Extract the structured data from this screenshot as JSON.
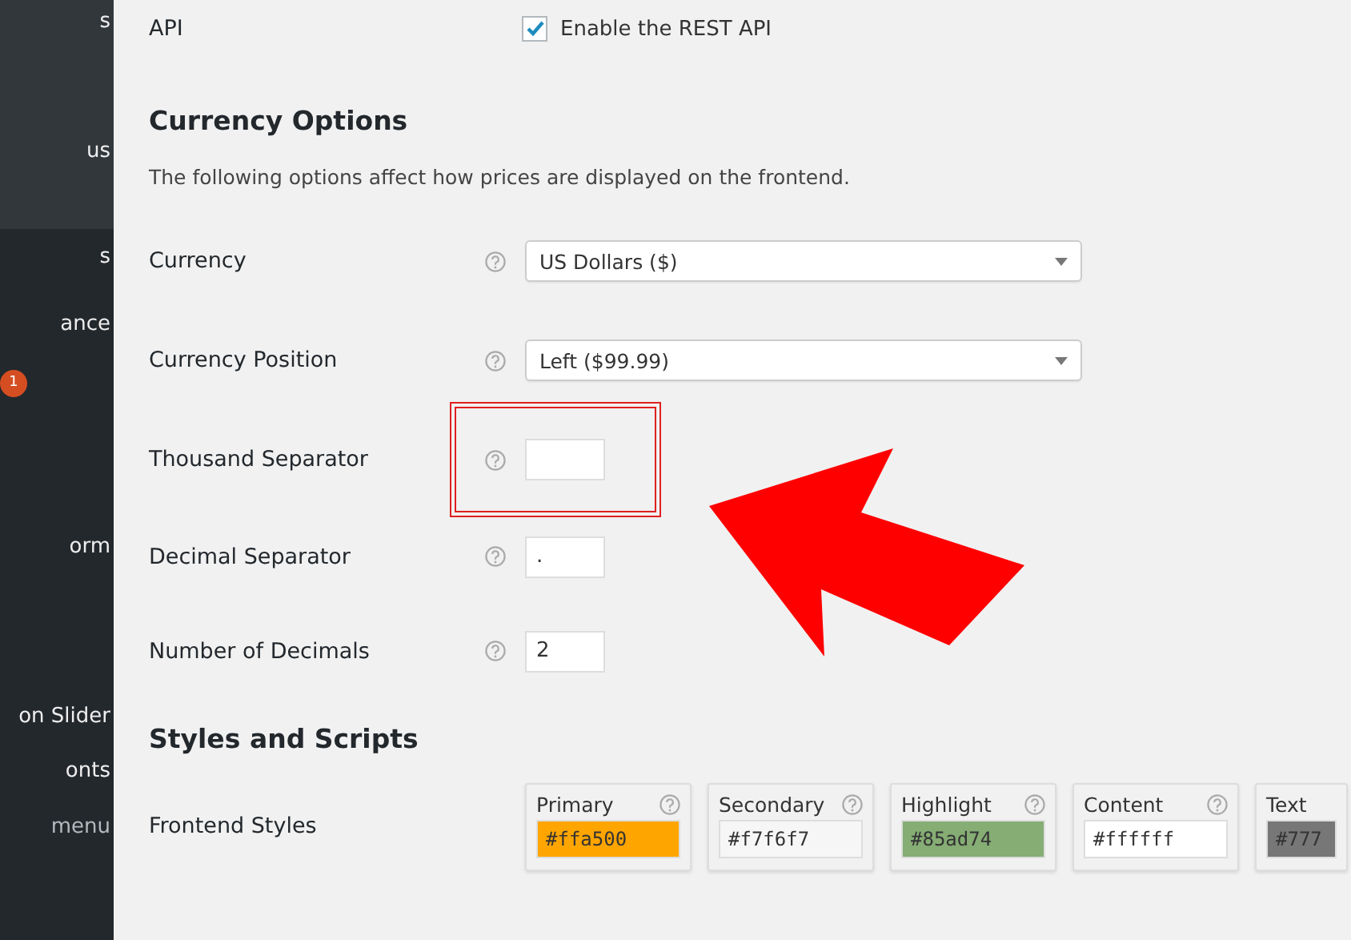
{
  "sidebar": {
    "submenu_items": [
      {
        "label": "s"
      },
      {
        "label": "us"
      }
    ],
    "items": [
      {
        "label": "s",
        "muted": false
      },
      {
        "label": "ance",
        "muted": false
      },
      {
        "badge": "1",
        "muted": false
      },
      {
        "label": "orm",
        "muted": false
      },
      {
        "label": "on Slider",
        "muted": false
      },
      {
        "label": "onts",
        "muted": false
      },
      {
        "label": "menu",
        "muted": true
      }
    ]
  },
  "api": {
    "label": "API",
    "checkbox": {
      "label": "Enable the REST API",
      "checked": true
    }
  },
  "currency_options": {
    "heading": "Currency Options",
    "description": "The following options affect how prices are displayed on the frontend.",
    "fields": [
      {
        "kind": "select",
        "label": "Currency",
        "value": "US Dollars ($)",
        "highlighted": false
      },
      {
        "kind": "select",
        "label": "Currency Position",
        "value": "Left ($99.99)",
        "highlighted": false
      },
      {
        "kind": "text",
        "label": "Thousand Separator",
        "highlighted": true
      },
      {
        "kind": "text",
        "label": "Decimal Separator",
        "value": ".",
        "highlighted": false
      },
      {
        "kind": "text",
        "label": "Number of Decimals",
        "value": "2",
        "highlighted": false
      }
    ]
  },
  "styles_and_scripts": {
    "heading": "Styles and Scripts",
    "frontend_styles": {
      "label": "Frontend Styles",
      "colors": [
        {
          "label": "Primary",
          "value": "#ffa500",
          "color": "#ffa500"
        },
        {
          "label": "Secondary",
          "value": "#f7f6f7",
          "color": "#f7f6f7"
        },
        {
          "label": "Highlight",
          "value": "#85ad74",
          "color": "#85ad74"
        },
        {
          "label": "Content",
          "value": "#ffffff",
          "color": "#ffffff"
        },
        {
          "label": "Text",
          "value": "#777",
          "color": "#777777"
        }
      ]
    }
  }
}
